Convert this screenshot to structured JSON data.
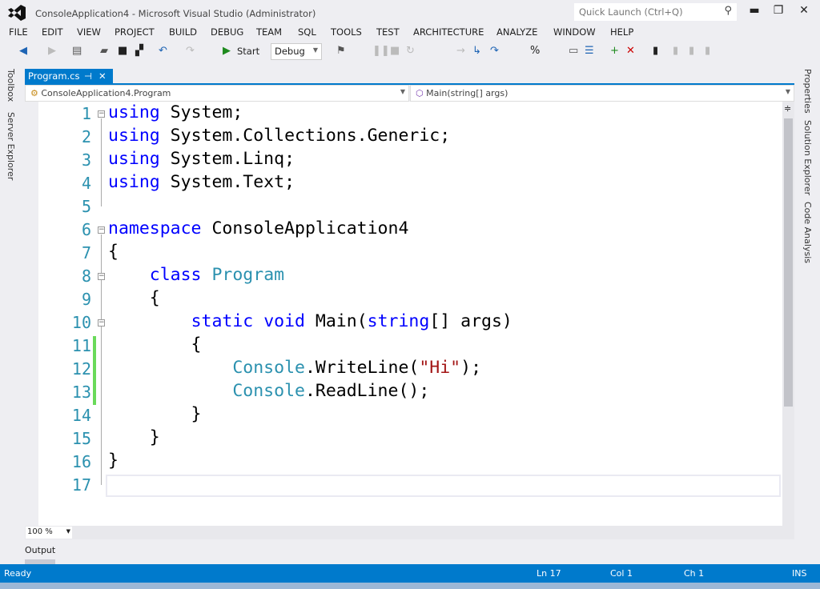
{
  "window": {
    "title": "ConsoleApplication4 - Microsoft Visual Studio (Administrator)",
    "quick_launch_placeholder": "Quick Launch (Ctrl+Q)"
  },
  "menu": [
    "FILE",
    "EDIT",
    "VIEW",
    "PROJECT",
    "BUILD",
    "DEBUG",
    "TEAM",
    "SQL",
    "TOOLS",
    "TEST",
    "ARCHITECTURE",
    "ANALYZE",
    "WINDOW",
    "HELP"
  ],
  "toolbar": {
    "start_label": "Start",
    "config": "Debug"
  },
  "left_panels": [
    "Toolbox",
    "Server Explorer"
  ],
  "right_panels": [
    "Properties",
    "Solution Explorer",
    "Code Analysis"
  ],
  "tab": {
    "label": "Program.cs"
  },
  "nav": {
    "type": "ConsoleApplication4.Program",
    "member": "Main(string[] args)"
  },
  "code": [
    [
      [
        "using",
        "kw"
      ],
      [
        " System;",
        ""
      ]
    ],
    [
      [
        "using",
        "kw"
      ],
      [
        " System.Collections.Generic;",
        ""
      ]
    ],
    [
      [
        "using",
        "kw"
      ],
      [
        " System.Linq;",
        ""
      ]
    ],
    [
      [
        "using",
        "kw"
      ],
      [
        " System.Text;",
        ""
      ]
    ],
    [],
    [
      [
        "namespace",
        "kw"
      ],
      [
        " ConsoleApplication4",
        ""
      ]
    ],
    [
      [
        "{",
        ""
      ]
    ],
    [
      [
        "    ",
        ""
      ],
      [
        "class",
        "kw"
      ],
      [
        " ",
        ""
      ],
      [
        "Program",
        "ty"
      ]
    ],
    [
      [
        "    {",
        ""
      ]
    ],
    [
      [
        "        ",
        ""
      ],
      [
        "static",
        "kw"
      ],
      [
        " ",
        ""
      ],
      [
        "void",
        "kw"
      ],
      [
        " Main(",
        ""
      ],
      [
        "string",
        "kw"
      ],
      [
        "[] args)",
        ""
      ]
    ],
    [
      [
        "        {",
        ""
      ]
    ],
    [
      [
        "            ",
        ""
      ],
      [
        "Console",
        "ty"
      ],
      [
        ".WriteLine(",
        ""
      ],
      [
        "\"Hi\"",
        "str"
      ],
      [
        ");",
        ""
      ]
    ],
    [
      [
        "            ",
        ""
      ],
      [
        "Console",
        "ty"
      ],
      [
        ".ReadLine();",
        ""
      ]
    ],
    [
      [
        "        }",
        ""
      ]
    ],
    [
      [
        "    }",
        ""
      ]
    ],
    [
      [
        "}",
        ""
      ]
    ],
    []
  ],
  "editor": {
    "zoom": "100 %"
  },
  "output_label": "Output",
  "status": {
    "state": "Ready",
    "ln": "Ln 17",
    "col": "Col 1",
    "ch": "Ch 1",
    "mode": "INS"
  }
}
